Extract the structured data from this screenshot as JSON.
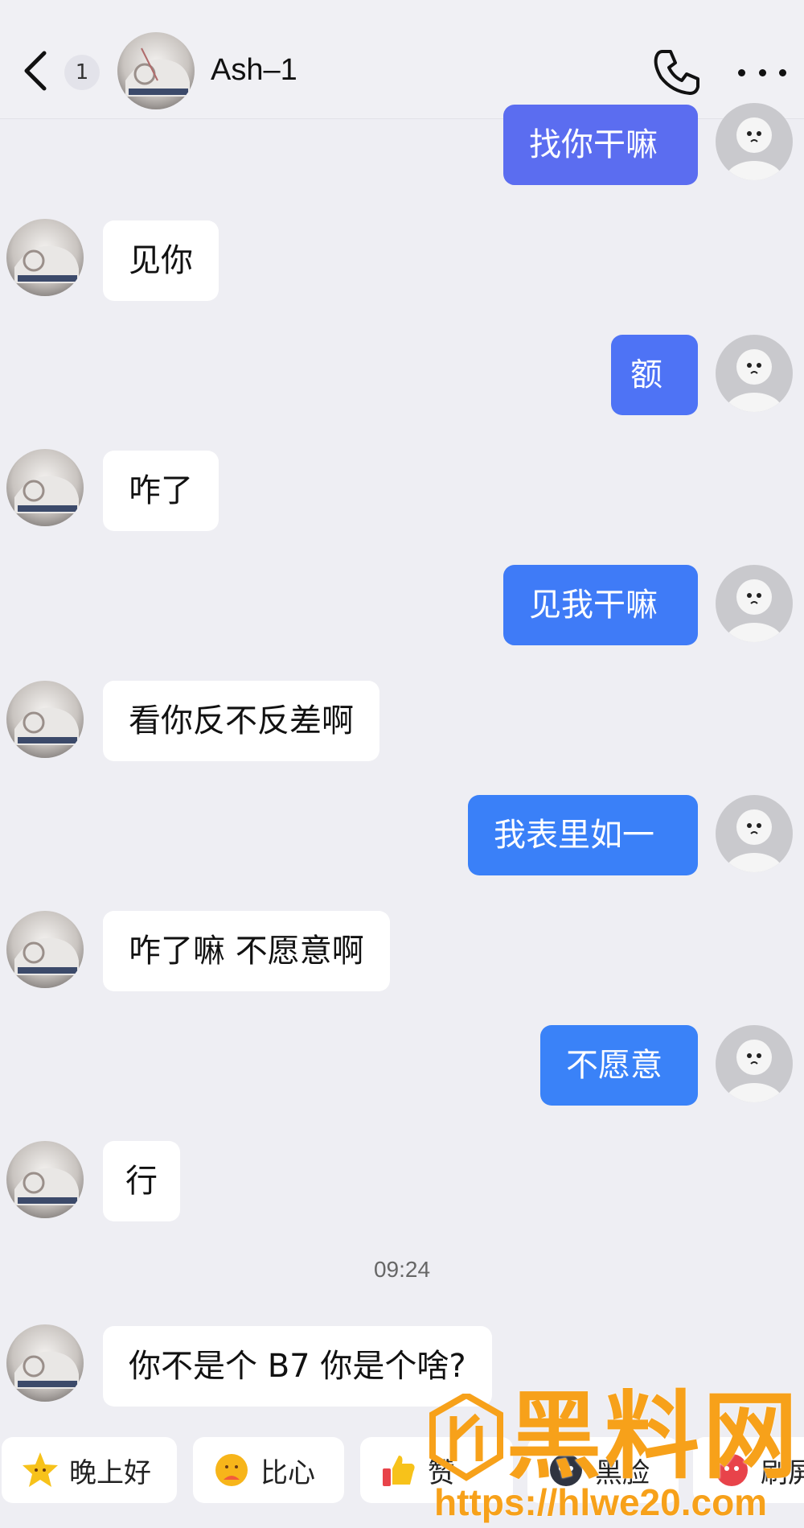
{
  "header": {
    "unread_count": "1",
    "contact_name": "Ash–1"
  },
  "messages": [
    {
      "side": "out",
      "text": "找你干嘛"
    },
    {
      "side": "in",
      "text": "见你"
    },
    {
      "side": "out",
      "text": "额"
    },
    {
      "side": "in",
      "text": "咋了"
    },
    {
      "side": "out",
      "text": "见我干嘛"
    },
    {
      "side": "in",
      "text": "看你反不反差啊"
    },
    {
      "side": "out",
      "text": "我表里如一"
    },
    {
      "side": "in",
      "text": "咋了嘛 不愿意啊"
    },
    {
      "side": "out",
      "text": "不愿意"
    },
    {
      "side": "in",
      "text": "行"
    },
    {
      "side": "in",
      "text": "你不是个 B7 你是个啥?"
    }
  ],
  "timestamp": "09:24",
  "quick_replies": [
    {
      "label": "晚上好",
      "icon": "star-face-icon"
    },
    {
      "label": "比心",
      "icon": "heart-hands-icon"
    },
    {
      "label": "赞",
      "icon": "thumbs-up-icon"
    },
    {
      "label": "黑脸",
      "icon": "dark-face-icon"
    },
    {
      "label": "刷屏",
      "icon": "red-face-icon"
    }
  ],
  "watermark": {
    "title": "黑料网",
    "url": "https://hlwe20.com"
  },
  "colors": {
    "background": "#eeeef3",
    "outgoing_bubble": "#4f6ff4",
    "incoming_bubble": "#ffffff",
    "watermark": "#f7a11a"
  }
}
